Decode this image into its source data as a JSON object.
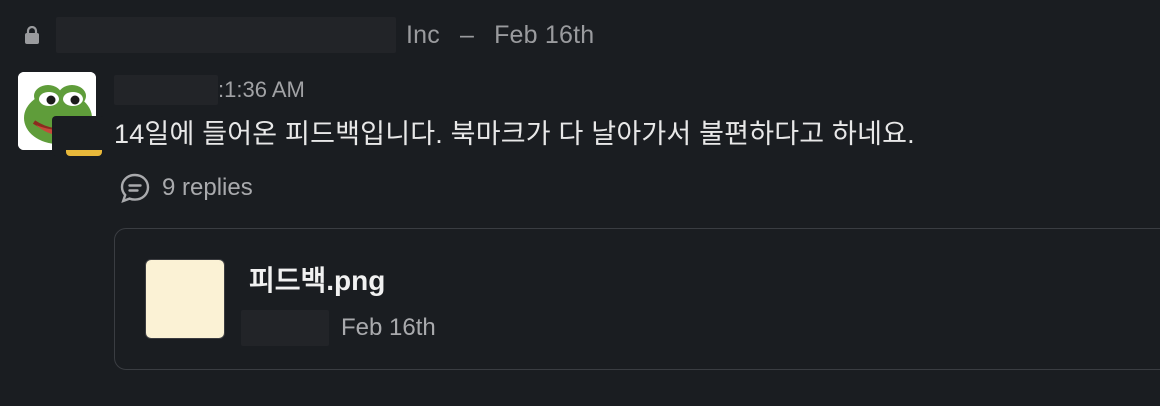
{
  "header": {
    "org_suffix": "Inc",
    "separator": "–",
    "date": "Feb 16th"
  },
  "message": {
    "time": ":1:36 AM",
    "text": "14일에 들어온 피드백입니다. 북마크가 다 날아가서 불편하다고 하네요.",
    "replies_label": "9 replies"
  },
  "file": {
    "name": "피드백.png",
    "date": "Feb 16th"
  },
  "colors": {
    "background": "#1a1d21",
    "status": "#e8b83a",
    "thumbnail": "#fbf2d5"
  },
  "icons": {
    "lock": "lock-icon",
    "replies": "speech-bubble-icon"
  }
}
